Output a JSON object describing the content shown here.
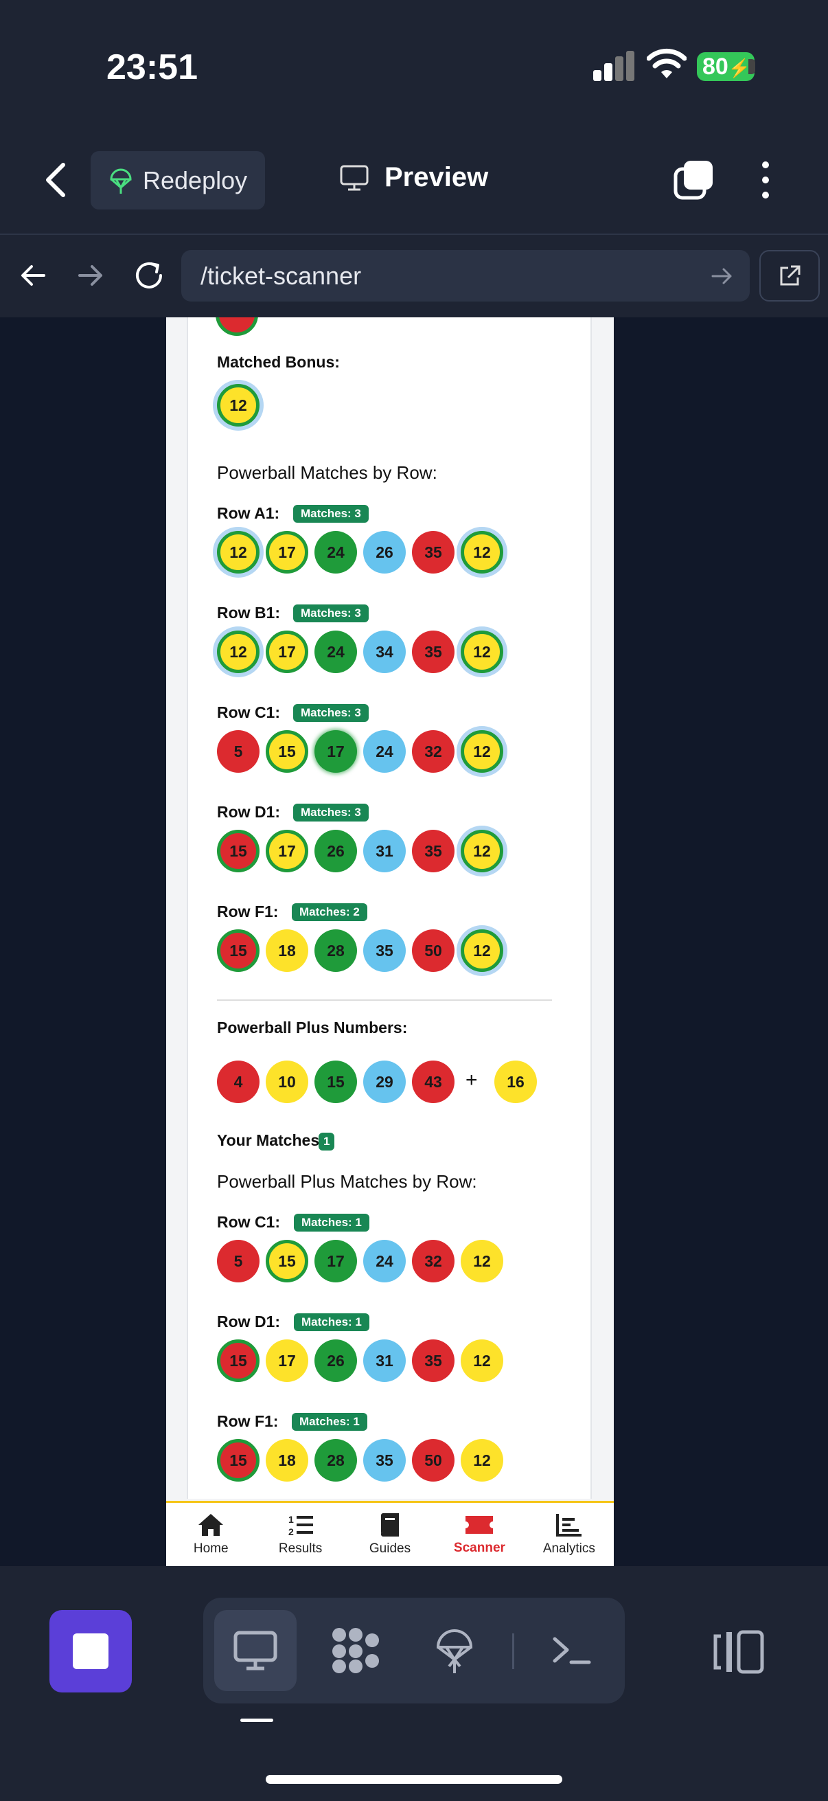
{
  "status_bar": {
    "time": "23:51",
    "battery": "80"
  },
  "header": {
    "redeploy_label": "Redeploy",
    "preview_label": "Preview"
  },
  "browser": {
    "url": "/ticket-scanner"
  },
  "results": {
    "matched_bonus_label": "Matched Bonus:",
    "matched_bonus_ball": "12",
    "powerball_heading": "Powerball Matches by Row:",
    "powerball_rows": [
      {
        "label": "Row A1:",
        "badge": "Matches: 3",
        "balls": [
          "12",
          "17",
          "24",
          "26",
          "35",
          "12"
        ]
      },
      {
        "label": "Row B1:",
        "badge": "Matches: 3",
        "balls": [
          "12",
          "17",
          "24",
          "34",
          "35",
          "12"
        ]
      },
      {
        "label": "Row C1:",
        "badge": "Matches: 3",
        "balls": [
          "5",
          "15",
          "17",
          "24",
          "32",
          "12"
        ]
      },
      {
        "label": "Row D1:",
        "badge": "Matches: 3",
        "balls": [
          "15",
          "17",
          "26",
          "31",
          "35",
          "12"
        ]
      },
      {
        "label": "Row F1:",
        "badge": "Matches: 2",
        "balls": [
          "15",
          "18",
          "28",
          "35",
          "50",
          "12"
        ]
      }
    ],
    "plus_label": "Powerball Plus Numbers:",
    "plus_numbers": [
      "4",
      "10",
      "15",
      "29",
      "43"
    ],
    "plus_sign": "+",
    "plus_bonus": "16",
    "your_matches_label": "Your Matches:",
    "your_matches_count": "1",
    "plus_heading": "Powerball Plus Matches by Row:",
    "plus_rows": [
      {
        "label": "Row C1:",
        "badge": "Matches: 1",
        "balls": [
          "5",
          "15",
          "17",
          "24",
          "32",
          "12"
        ]
      },
      {
        "label": "Row D1:",
        "badge": "Matches: 1",
        "balls": [
          "15",
          "17",
          "26",
          "31",
          "35",
          "12"
        ]
      },
      {
        "label": "Row F1:",
        "badge": "Matches: 1",
        "balls": [
          "15",
          "18",
          "28",
          "35",
          "50",
          "12"
        ]
      }
    ]
  },
  "bottom_nav": {
    "items": [
      {
        "label": "Home",
        "icon": "home-icon"
      },
      {
        "label": "Results",
        "icon": "list-icon"
      },
      {
        "label": "Guides",
        "icon": "book-icon"
      },
      {
        "label": "Scanner",
        "icon": "ticket-icon"
      },
      {
        "label": "Analytics",
        "icon": "chart-icon"
      }
    ]
  },
  "colors": {
    "red": "#dc2a2f",
    "yellow": "#fde22a",
    "green": "#1f9b3a",
    "blue": "#66c3ee",
    "badge": "#198754",
    "accent": "#5b3fd8"
  }
}
